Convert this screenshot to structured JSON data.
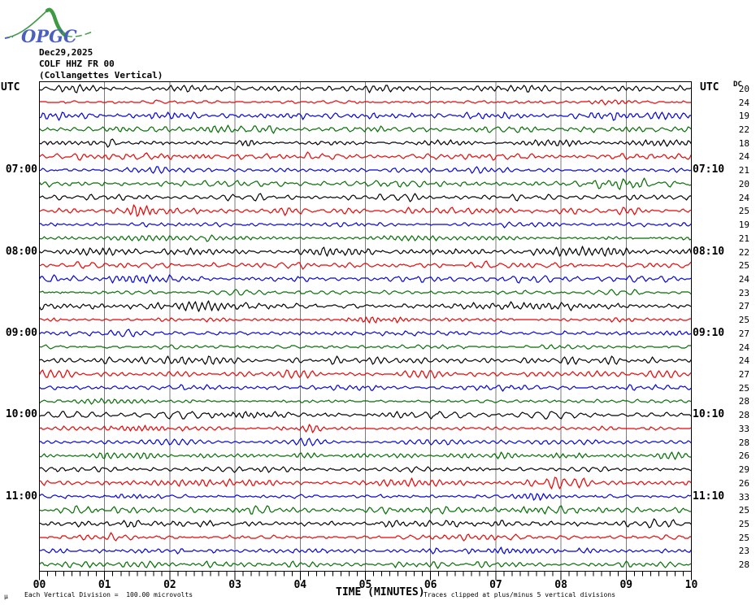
{
  "logo": {
    "text": "OPGC",
    "curve_color": "#3f9a44",
    "text_color": "#4a5fc0"
  },
  "header": {
    "date": "Dec29,2025",
    "station": "COLF HHZ FR 00",
    "subtitle": "(Collangettes Vertical)"
  },
  "axes": {
    "left_corner_label": "UTC",
    "right_corner_label": "UTC",
    "dc_header": "DC"
  },
  "footer": {
    "mu_mark": "µ",
    "scale_note": "Each Vertical Division =  100.00 microvolts",
    "x_axis_title": "TIME (MINUTES)",
    "clip_note": "Traces clipped at plus/minus 5 vertical divisions"
  },
  "chart_data": {
    "type": "line",
    "subtype": "helicorder drum seismogram, one 10-minute trace per row",
    "title": "COLF HHZ FR 00",
    "station_description": "(Collangettes Vertical)",
    "date": "Dec29,2025",
    "xlabel": "TIME (MINUTES)",
    "x_ticks": [
      "00",
      "01",
      "02",
      "03",
      "04",
      "05",
      "06",
      "07",
      "08",
      "09",
      "10"
    ],
    "x_range_minutes": [
      0,
      10
    ],
    "minor_tick_intervals_per_minute": 8,
    "num_rows": 36,
    "minutes_per_row": 10,
    "grid_on": true,
    "grid_color": "#7a7a7a",
    "border_color": "#000000",
    "trace_color_cycle": [
      "#000000",
      "#ee0000",
      "#0000e0",
      "#006e00"
    ],
    "left_hour_labels": [
      {
        "row": 6,
        "label": "07:00"
      },
      {
        "row": 12,
        "label": "08:00"
      },
      {
        "row": 18,
        "label": "09:00"
      },
      {
        "row": 24,
        "label": "10:00"
      },
      {
        "row": 30,
        "label": "11:00"
      }
    ],
    "right_hour_labels": [
      {
        "row": 6,
        "label": "07:10"
      },
      {
        "row": 12,
        "label": "08:10"
      },
      {
        "row": 18,
        "label": "09:10"
      },
      {
        "row": 24,
        "label": "10:10"
      },
      {
        "row": 30,
        "label": "11:10"
      }
    ],
    "dc_header": "DC",
    "dc_values": [
      20,
      24,
      19,
      22,
      18,
      24,
      21,
      20,
      24,
      25,
      19,
      21,
      22,
      25,
      24,
      23,
      27,
      25,
      27,
      24,
      24,
      27,
      25,
      28,
      28,
      33,
      28,
      26,
      29,
      26,
      33,
      25,
      25,
      25,
      23,
      28
    ]
  }
}
